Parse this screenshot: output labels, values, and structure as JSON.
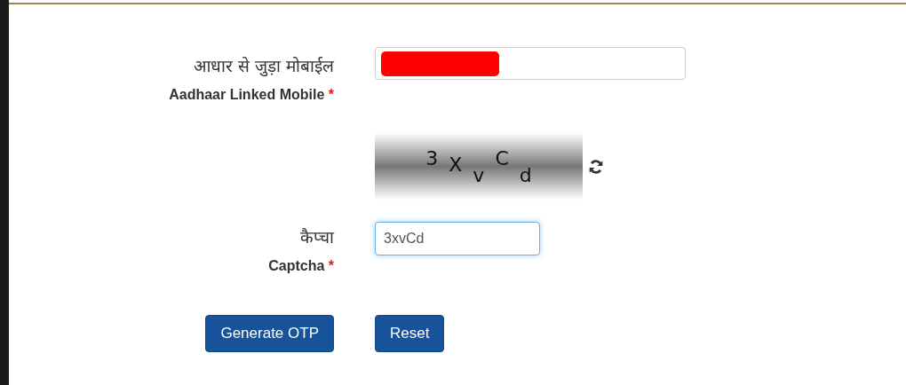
{
  "mobile": {
    "label_hi": "आधार से जुड़ा मोबाईल",
    "label_en": "Aadhaar Linked Mobile",
    "required": "*",
    "redacted": true
  },
  "captcha_image": {
    "chars": [
      {
        "char": "3",
        "kind": "raised"
      },
      {
        "char": "X",
        "kind": "middle"
      },
      {
        "char": "v",
        "kind": "lowered"
      },
      {
        "char": "C",
        "kind": "raised"
      },
      {
        "char": "d",
        "kind": "lowered"
      }
    ]
  },
  "captcha": {
    "label_hi": "कैप्चा",
    "label_en": "Captcha",
    "required": "*",
    "value": "3xvCd",
    "focused": true
  },
  "buttons": [
    {
      "label": "Generate OTP"
    },
    {
      "label": "Reset"
    }
  ]
}
